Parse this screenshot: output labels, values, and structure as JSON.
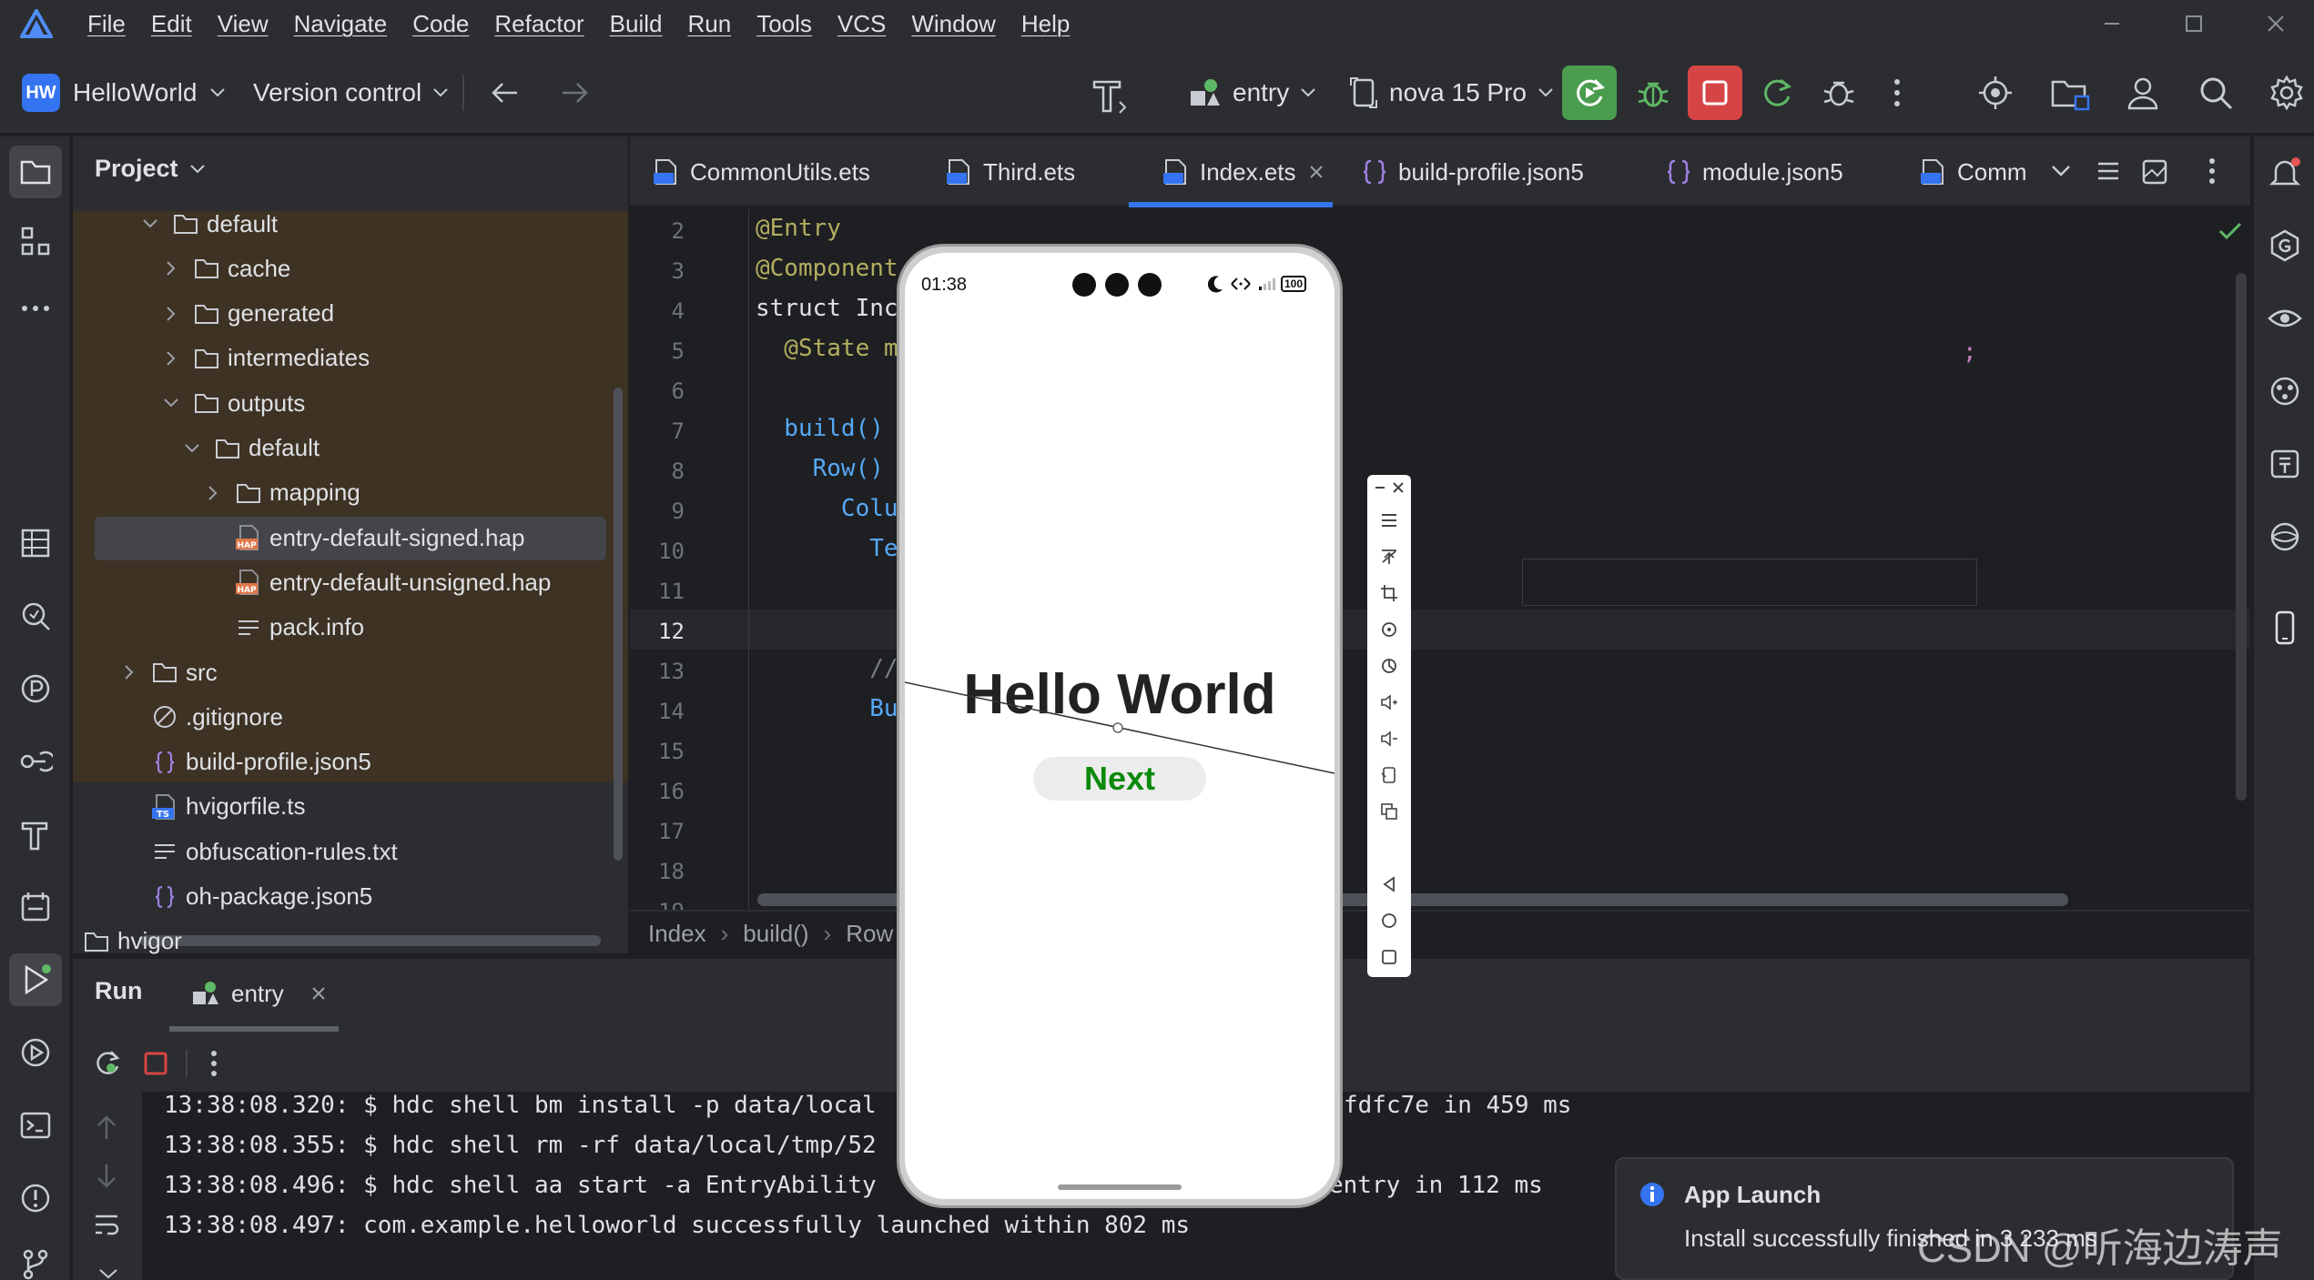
{
  "menubar": {
    "items": [
      "File",
      "Edit",
      "View",
      "Navigate",
      "Code",
      "Refactor",
      "Build",
      "Run",
      "Tools",
      "VCS",
      "Window",
      "Help"
    ]
  },
  "toolbar": {
    "project_badge": "HW",
    "project_name": "HelloWorld",
    "vcs_label": "Version control",
    "run_config": "entry",
    "device": "nova 15 Pro"
  },
  "project_panel": {
    "title": "Project",
    "tree": [
      {
        "label": "default",
        "type": "folder",
        "expanded": true
      },
      {
        "label": "cache",
        "type": "folder",
        "expanded": false
      },
      {
        "label": "generated",
        "type": "folder",
        "expanded": false
      },
      {
        "label": "intermediates",
        "type": "folder",
        "expanded": false
      },
      {
        "label": "outputs",
        "type": "folder",
        "expanded": true
      },
      {
        "label": "default",
        "type": "folder",
        "expanded": true
      },
      {
        "label": "mapping",
        "type": "folder",
        "expanded": false
      },
      {
        "label": "entry-default-signed.hap",
        "type": "hap",
        "selected": true
      },
      {
        "label": "entry-default-unsigned.hap",
        "type": "hap"
      },
      {
        "label": "pack.info",
        "type": "text"
      },
      {
        "label": "src",
        "type": "folder",
        "expanded": false
      },
      {
        "label": ".gitignore",
        "type": "ignore"
      },
      {
        "label": "build-profile.json5",
        "type": "json"
      },
      {
        "label": "hvigorfile.ts",
        "type": "ts"
      },
      {
        "label": "obfuscation-rules.txt",
        "type": "text"
      },
      {
        "label": "oh-package.json5",
        "type": "json"
      },
      {
        "label": "hvigor",
        "type": "folder"
      }
    ],
    "hap_badge": "HAP",
    "ts_badge": "TS"
  },
  "tabs": [
    {
      "label": "CommonUtils.ets",
      "icon": "ets-file-icon"
    },
    {
      "label": "Third.ets",
      "icon": "ets-file-icon"
    },
    {
      "label": "Index.ets",
      "icon": "ets-file-icon",
      "active": true
    },
    {
      "label": "build-profile.json5",
      "icon": "json-file-icon"
    },
    {
      "label": "module.json5",
      "icon": "json-file-icon"
    },
    {
      "label": "Comm",
      "icon": "ets-file-icon"
    }
  ],
  "editor": {
    "line_numbers": [
      "2",
      "3",
      "4",
      "5",
      "6",
      "7",
      "8",
      "9",
      "10",
      "11",
      "12",
      "13",
      "14",
      "15",
      "16",
      "17",
      "18",
      "19"
    ],
    "lines": [
      {
        "text": "@Entry",
        "color": "#b3ae60"
      },
      {
        "text": "@Component",
        "color": "#b3ae60"
      },
      {
        "text": "struct Inc",
        "color": "#dfe1e5"
      },
      {
        "text": "  @State m",
        "color": "#b3ae60"
      },
      {
        "text": "",
        "color": "#dfe1e5"
      },
      {
        "text": "  build()",
        "color": "#56a8f5"
      },
      {
        "text": "    Row()",
        "color": "#56a8f5"
      },
      {
        "text": "      Colu",
        "color": "#56a8f5"
      },
      {
        "text": "        Te",
        "color": "#56a8f5"
      },
      {
        "text": "",
        "color": "#dfe1e5"
      },
      {
        "text": "",
        "color": "#dfe1e5"
      },
      {
        "text": "        //",
        "color": "#7a7e85"
      },
      {
        "text": "        Bu",
        "color": "#56a8f5"
      },
      {
        "text": "",
        "color": "#dfe1e5"
      },
      {
        "text": "",
        "color": "#dfe1e5"
      },
      {
        "text": "",
        "color": "#dfe1e5"
      },
      {
        "text": "",
        "color": "#dfe1e5"
      },
      {
        "text": "",
        "color": "#dfe1e5"
      }
    ],
    "semicolon": ";",
    "current_line": "12"
  },
  "breadcrumbs": [
    "Index",
    "build()",
    "Row"
  ],
  "run_panel": {
    "title": "Run",
    "tab_label": "entry",
    "console_lines": [
      "13:38:08.320: $ hdc shell bm install -p data/local",
      "13:38:08.355: $ hdc shell rm -rf data/local/tmp/52",
      "13:38:08.496: $ hdc shell aa start -a EntryAbility",
      "13:38:08.497: com.example.helloworld successfully launched within 802 ms"
    ],
    "console_tails": [
      "fdfc7e in 459 ms",
      "",
      "entry in 112 ms",
      ""
    ]
  },
  "phone": {
    "time": "01:38",
    "battery": "100",
    "hello_text": "Hello World",
    "next_button": "Next",
    "next_color": "#0a8a0a"
  },
  "notification": {
    "title": "App Launch",
    "body": "Install successfully finished in 3 233 ms",
    "watermark": "CSDN @听海边涛声"
  },
  "colors": {
    "run_button": "#4a9c4e",
    "stop_button": "#d64545",
    "accent": "#3574f0"
  }
}
